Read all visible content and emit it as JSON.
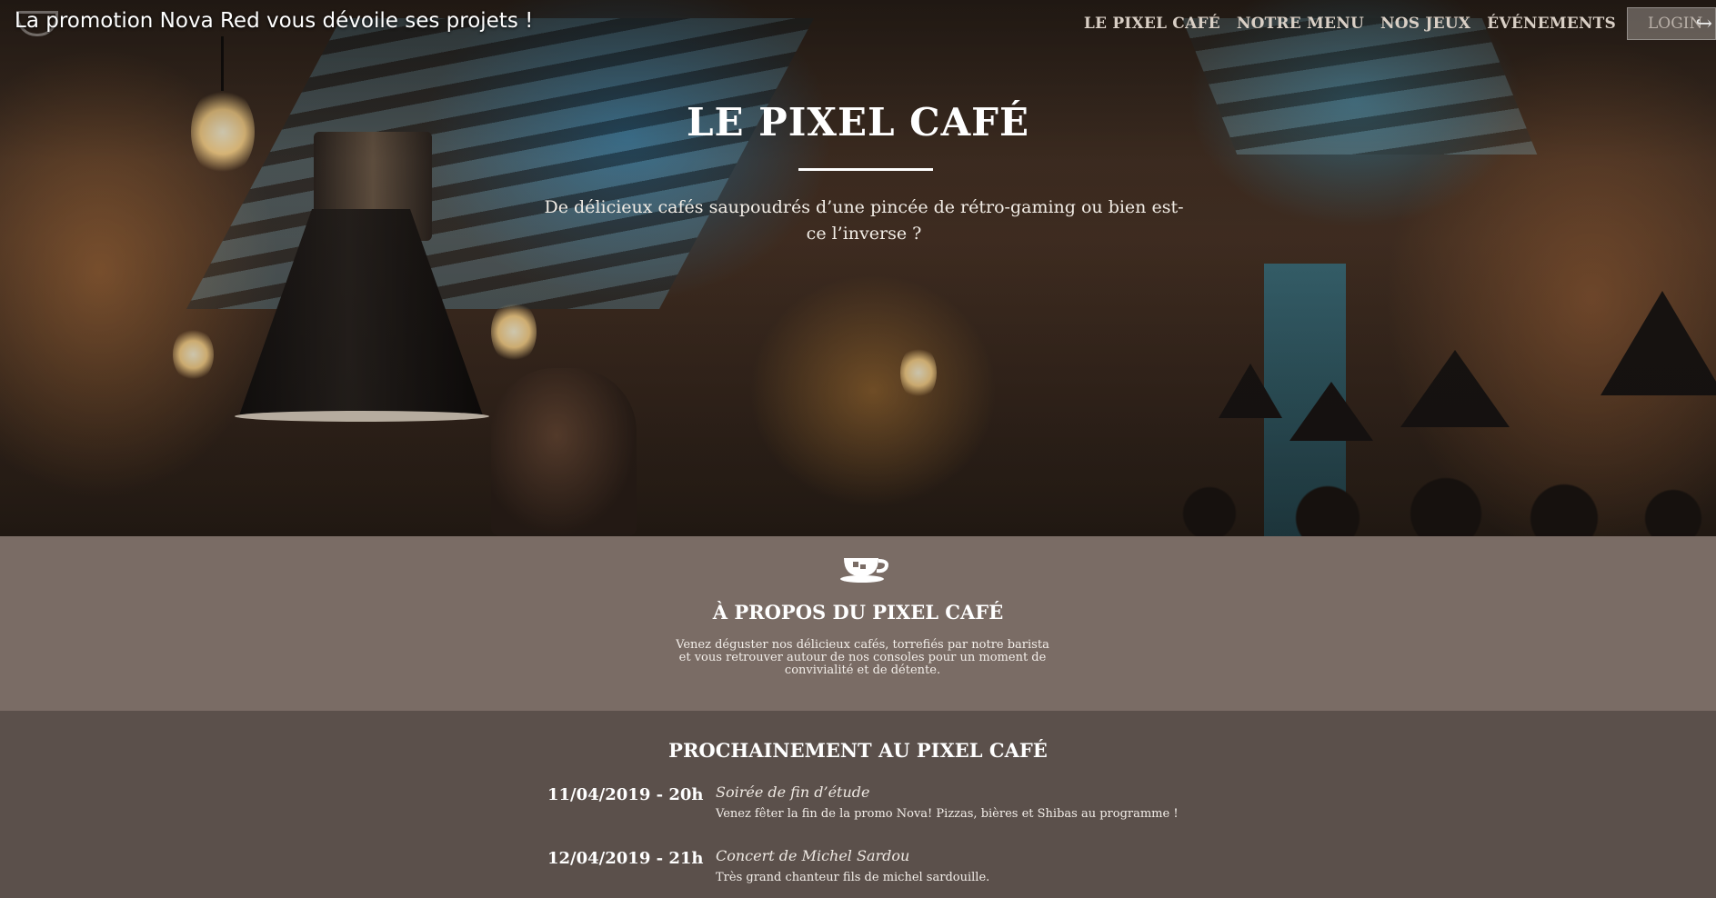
{
  "video": {
    "title": "La promotion Nova Red vous dévoile ses projets !"
  },
  "nav": {
    "items": [
      "LE PIXEL CAFÉ",
      "NOTRE MENU",
      "NOS JEUX",
      "ÉVÉNEMENTS"
    ],
    "login": "LOGIN"
  },
  "hero": {
    "title": "LE PIXEL CAFÉ",
    "subtitle": "De délicieux cafés saupoudrés d’une pincée de rétro-gaming ou bien est-ce l’inverse ?"
  },
  "about": {
    "title": "À PROPOS DU PIXEL CAFÉ",
    "text": "Venez déguster nos délicieux cafés, torrefiés par notre barista et vous retrouver autour de nos consoles pour un moment de convivialité et de détente."
  },
  "events": {
    "title": "PROCHAINEMENT AU PIXEL CAFÉ",
    "items": [
      {
        "date": "11/04/2019 - 20h",
        "name": "Soirée de fin d’étude",
        "desc": "Venez fêter la fin de la promo Nova! Pizzas, bières et Shibas au programme !"
      },
      {
        "date": "12/04/2019 - 21h",
        "name": "Concert de Michel Sardou",
        "desc": "Très grand chanteur fils de michel sardouille."
      }
    ]
  },
  "colors": {
    "about_bg": "#7a6c65",
    "events_bg": "#5b504b"
  }
}
